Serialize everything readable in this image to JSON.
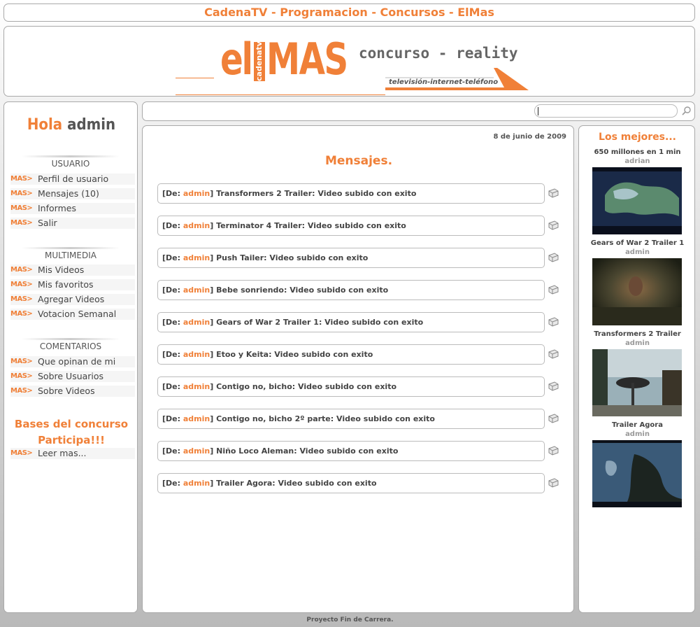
{
  "top_links": {
    "text": "CadenaTV - Programacion - Concursos - ElMas"
  },
  "banner": {
    "el": "el",
    "cadena": "cadenatv",
    "mas": "MAS",
    "concurso": "concurso - reality",
    "tagline": "televisión-internet-teléfono"
  },
  "sidebar": {
    "greeting": "Hola",
    "user": "admin",
    "item_tag": "MAS>",
    "sections": [
      {
        "title": "USUARIO",
        "items": [
          "Perfil de usuario",
          "Mensajes (10)",
          "Informes",
          "Salir"
        ]
      },
      {
        "title": "MULTIMEDIA",
        "items": [
          "Mis Videos",
          "Mis favoritos",
          "Agregar Videos",
          "Votacion Semanal"
        ]
      },
      {
        "title": "COMENTARIOS",
        "items": [
          "Que opinan de mi",
          "Sobre Usuarios",
          "Sobre Videos"
        ]
      }
    ],
    "bases_line1": "Bases del concurso",
    "bases_line2": "Participa!!!",
    "leer_mas": "Leer mas..."
  },
  "search": {
    "value": "",
    "placeholder": ""
  },
  "main": {
    "date": "8 de junio de 2009",
    "title": "Mensajes.",
    "from_prefix": "[De: ",
    "from_user": "admin",
    "from_suffix": "]",
    "messages": [
      "Transformers 2 Trailer: Video subido con exito",
      "Terminator 4 Trailer: Video subido con exito",
      "Push Tailer: Video subido con exito",
      "Bebe sonriendo: Video subido con exito",
      "Gears of War 2 Trailer 1: Video subido con exito",
      "Etoo y Keita: Video subido con exito",
      "Contigo no, bicho: Video subido con exito",
      "Contigo no, bicho 2º parte: Video subido con exito",
      "Niño Loco Aleman: Video subido con exito",
      "Trailer Agora: Video subido con exito"
    ]
  },
  "right": {
    "title": "Los mejores...",
    "videos": [
      {
        "title": "650 millones en 1 min",
        "author": "adrian"
      },
      {
        "title": "Gears of War 2 Trailer 1",
        "author": "admin"
      },
      {
        "title": "Transformers 2 Trailer",
        "author": "admin"
      },
      {
        "title": "Trailer Agora",
        "author": "admin"
      }
    ]
  },
  "footer": "Proyecto Fin de Carrera.",
  "colors": {
    "accent": "#f08038",
    "text": "#444444",
    "border": "#a9a9a9"
  }
}
